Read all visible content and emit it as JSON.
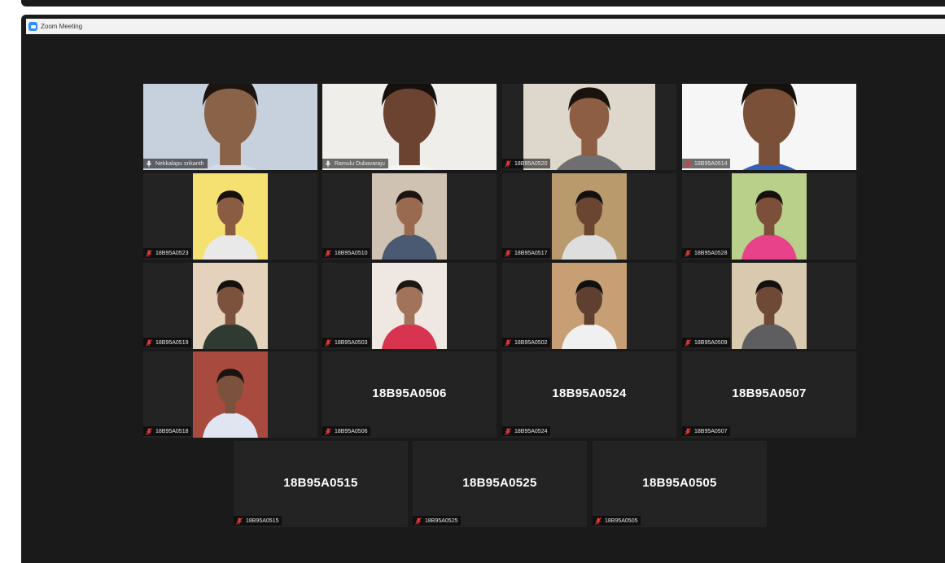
{
  "window": {
    "title": "Zoom Meeting",
    "app_icon": "zoom-icon"
  },
  "tiles": [
    {
      "name": "Nekkalapu srikanth",
      "muted": false,
      "video": true,
      "bg": "#c7d1dd",
      "shirt": "#d6d9e6",
      "skin": "#8a6247",
      "hair": "#1c1411"
    },
    {
      "name": "Ramulu Dubavaraju",
      "muted": false,
      "video": true,
      "active": true,
      "bg": "#f0eeea",
      "shirt": "#f4f4f2",
      "skin": "#6b4330",
      "hair": "#16100d"
    },
    {
      "name": "18B95A0520",
      "muted": true,
      "video": true,
      "bg": "#ded8cc",
      "shirt": "#6f6f72",
      "skin": "#8d5e44",
      "hair": "#1a120e"
    },
    {
      "name": "18B95A0514",
      "muted": true,
      "video": true,
      "bg": "#f6f6f6",
      "shirt": "#3560b8",
      "skin": "#7a5138",
      "hair": "#15100c"
    },
    {
      "name": "18B95A0523",
      "muted": true,
      "video": true,
      "bg": "#f5e172",
      "shirt": "#e9e9e9",
      "skin": "#8a5d43",
      "hair": "#17110d"
    },
    {
      "name": "18B95A0510",
      "muted": true,
      "video": true,
      "bg": "#cfc2b3",
      "shirt": "#4a5a72",
      "skin": "#9a6a50",
      "hair": "#1b1410"
    },
    {
      "name": "18B95A0517",
      "muted": true,
      "video": true,
      "bg": "#b99a6c",
      "shirt": "#dedede",
      "skin": "#6a4532",
      "hair": "#121010"
    },
    {
      "name": "18B95A0528",
      "muted": true,
      "video": true,
      "bg": "#b8d08a",
      "shirt": "#e8428a",
      "skin": "#7c4f3a",
      "hair": "#15100d"
    },
    {
      "name": "18B95A0519",
      "muted": true,
      "video": true,
      "bg": "#e4d2bd",
      "shirt": "#2f3a33",
      "skin": "#7c523d",
      "hair": "#14100e"
    },
    {
      "name": "18B95A0503",
      "muted": true,
      "video": true,
      "bg": "#efe8e2",
      "shirt": "#d8344f",
      "skin": "#a0735a",
      "hair": "#1c1511"
    },
    {
      "name": "18B95A0502",
      "muted": true,
      "video": true,
      "bg": "#c89f75",
      "shirt": "#f0f0f0",
      "skin": "#5f3f2f",
      "hair": "#111010"
    },
    {
      "name": "18B95A0509",
      "muted": true,
      "video": true,
      "bg": "#d9c9ae",
      "shirt": "#5e5e60",
      "skin": "#6e4a36",
      "hair": "#141010"
    },
    {
      "name": "18B95A0518",
      "muted": true,
      "video": true,
      "bg": "#a94a3e",
      "shirt": "#dfe6f2",
      "skin": "#7d523c",
      "hair": "#1a1310"
    },
    {
      "name": "18B95A0506",
      "muted": true,
      "video": false,
      "label": "18B95A0506"
    },
    {
      "name": "18B95A0524",
      "muted": true,
      "video": false,
      "label": "18B95A0524"
    },
    {
      "name": "18B95A0507",
      "muted": true,
      "video": false,
      "label": "18B95A0507"
    },
    {
      "name": "18B95A0515",
      "muted": true,
      "video": false,
      "label": "18B95A0515"
    },
    {
      "name": "18B95A0525",
      "muted": true,
      "video": false,
      "label": "18B95A0525"
    },
    {
      "name": "18B95A0505",
      "muted": true,
      "video": false,
      "label": "18B95A0505"
    }
  ],
  "colors": {
    "window_bg": "#1a1a1a",
    "tile_bg": "#232323",
    "active_border": "#9ccc3a",
    "muted_mic": "#e53935"
  }
}
